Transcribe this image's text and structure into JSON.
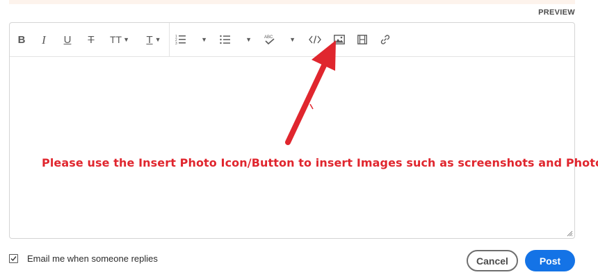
{
  "header": {
    "preview_label": "PREVIEW"
  },
  "toolbar": {
    "buttons": [
      {
        "name": "bold",
        "glyph": "B"
      },
      {
        "name": "italic",
        "glyph": "I"
      },
      {
        "name": "underline",
        "glyph": "U"
      },
      {
        "name": "strikethrough",
        "glyph": "T"
      },
      {
        "name": "font-size",
        "glyph": "TT"
      },
      {
        "name": "text-color",
        "glyph": "T"
      },
      {
        "name": "numbered-list"
      },
      {
        "name": "bulleted-list"
      },
      {
        "name": "spellcheck",
        "glyph": "ABC"
      },
      {
        "name": "code"
      },
      {
        "name": "insert-photo"
      },
      {
        "name": "insert-video"
      },
      {
        "name": "insert-link"
      }
    ]
  },
  "editor": {
    "annotation_text": "Please use the Insert Photo Icon/Button to insert Images such as screenshots and Photos",
    "annotation_color": "#e0262e"
  },
  "footer": {
    "email_checkbox_label": "Email me when someone replies",
    "email_checkbox_checked": true,
    "cancel_label": "Cancel",
    "post_label": "Post",
    "post_color": "#1473e6"
  }
}
